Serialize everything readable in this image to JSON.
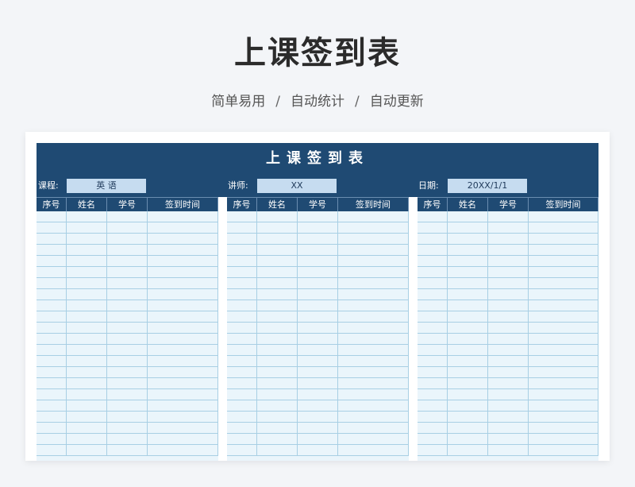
{
  "header": {
    "title": "上课签到表",
    "features": [
      "简单易用",
      "自动统计",
      "自动更新"
    ],
    "separator": "/"
  },
  "sheet": {
    "title": "上课签到表",
    "course_label": "课程:",
    "course_value": "英 语",
    "teacher_label": "讲师:",
    "teacher_value": "XX",
    "date_label": "日期:",
    "date_value": "20XX/1/1",
    "columns": [
      "序号",
      "姓名",
      "学号",
      "签到时间"
    ],
    "row_count": 22
  },
  "colors": {
    "header_bg": "#1f4a73",
    "value_bg": "#c6dcf0",
    "cell_bg": "#eaf5fb",
    "grid": "#a8cfe4"
  }
}
